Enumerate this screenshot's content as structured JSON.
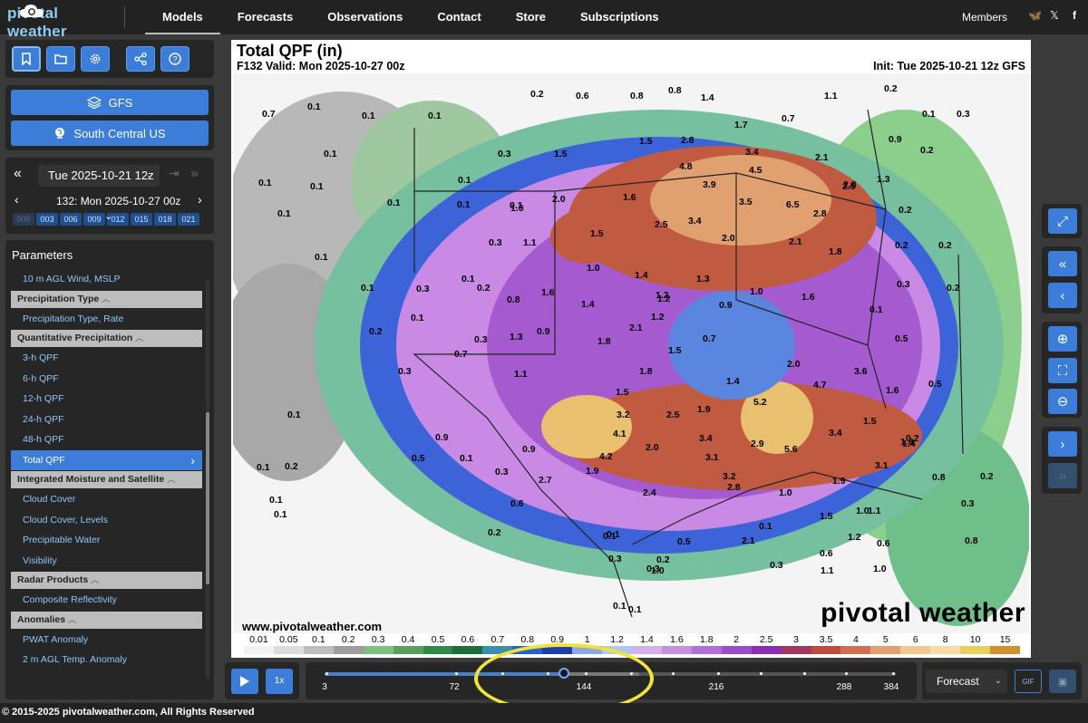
{
  "brand": {
    "name": "pivotal weather"
  },
  "nav": {
    "items": [
      "Models",
      "Forecasts",
      "Observations",
      "Contact",
      "Store",
      "Subscriptions"
    ],
    "members": "Members",
    "socials": [
      "bluesky-icon",
      "x-icon",
      "facebook-icon"
    ]
  },
  "sidebar": {
    "toolbar_icons": [
      "bookmark-icon",
      "folder-icon",
      "gear-icon",
      "share-icon",
      "help-icon"
    ],
    "model_label": "GFS",
    "region_label": "South Central US",
    "run_label": "Tue 2025-10-21 12z",
    "forecast_label": "132: Mon 2025-10-27 00z",
    "hour_chips": [
      "000",
      "003",
      "006",
      "009",
      "012",
      "015",
      "018",
      "021"
    ],
    "params_title": "Parameters",
    "params": [
      {
        "kind": "item",
        "label": "10 m AGL Wind, MSLP"
      },
      {
        "kind": "head",
        "label": "Precipitation Type"
      },
      {
        "kind": "item",
        "label": "Precipitation Type, Rate"
      },
      {
        "kind": "head",
        "label": "Quantitative Precipitation"
      },
      {
        "kind": "item",
        "label": "3-h QPF"
      },
      {
        "kind": "item",
        "label": "6-h QPF"
      },
      {
        "kind": "item",
        "label": "12-h QPF"
      },
      {
        "kind": "item",
        "label": "24-h QPF"
      },
      {
        "kind": "item",
        "label": "48-h QPF"
      },
      {
        "kind": "selected",
        "label": "Total QPF"
      },
      {
        "kind": "head",
        "label": "Integrated Moisture and Satellite"
      },
      {
        "kind": "item",
        "label": "Cloud Cover"
      },
      {
        "kind": "item",
        "label": "Cloud Cover, Levels"
      },
      {
        "kind": "item",
        "label": "Precipitable Water"
      },
      {
        "kind": "item",
        "label": "Visibility"
      },
      {
        "kind": "head",
        "label": "Radar Products"
      },
      {
        "kind": "item",
        "label": "Composite Reflectivity"
      },
      {
        "kind": "head",
        "label": "Anomalies"
      },
      {
        "kind": "item",
        "label": "PWAT Anomaly"
      },
      {
        "kind": "item",
        "label": "2 m AGL Temp. Anomaly"
      }
    ]
  },
  "map": {
    "title": "Total QPF (in)",
    "valid": "F132 Valid: Mon 2025-10-27 00z",
    "init": "Init: Tue 2025-10-21 12z GFS",
    "url": "www.pivotalweather.com",
    "watermark": "pivotal weather",
    "colorbar_labels": [
      "0.01",
      "0.05",
      "0.1",
      "0.2",
      "0.3",
      "0.4",
      "0.5",
      "0.6",
      "0.7",
      "0.8",
      "0.9",
      "1",
      "1.2",
      "1.4",
      "1.6",
      "1.8",
      "2",
      "2.5",
      "3",
      "3.5",
      "4",
      "5",
      "6",
      "8",
      "10",
      "15"
    ],
    "colorbar_colors": [
      "#f2f2f2",
      "#dcdcdc",
      "#bdbdbd",
      "#9e9e9e",
      "#7fbf7f",
      "#5aa05a",
      "#2f8a4a",
      "#1e6e3a",
      "#3a8fb0",
      "#2a5fd0",
      "#1f3fa8",
      "#8fa8e0",
      "#b0c8ee",
      "#d3b0e8",
      "#c890e0",
      "#b070d8",
      "#9a4fc8",
      "#8a2fb0",
      "#a03a60",
      "#c04a40",
      "#d07050",
      "#e0a070",
      "#f0c890",
      "#f7dca8",
      "#e8d060",
      "#d09030"
    ],
    "values": [
      "0.7",
      "0.1",
      "0.1",
      "0.1",
      "0.2",
      "0.6",
      "0.8",
      "0.8",
      "1.4",
      "1.1",
      "0.2",
      "0.1",
      "0.3",
      "1.7",
      "0.7",
      "0.2",
      "0.1",
      "0.3",
      "1.5",
      "1.5",
      "2.8",
      "3.4",
      "0.9",
      "4.8",
      "4.5",
      "2.1",
      "0.1",
      "0.1",
      "2.0",
      "2.8",
      "3.9",
      "2.5",
      "1.3",
      "0.1",
      "1.6",
      "3.5",
      "6.5",
      "0.2",
      "0.1",
      "0.1",
      "1.0",
      "2.5",
      "3.4",
      "2.8",
      "0.1",
      "0.1",
      "0.3",
      "1.1",
      "1.5",
      "2.0",
      "2.1",
      "0.2",
      "0.1",
      "1.0",
      "1.8",
      "0.2",
      "0.3",
      "0.2",
      "0.1",
      "0.1",
      "1.6",
      "1.4",
      "1.3",
      "1.0",
      "1.6",
      "0.3",
      "0.2",
      "0.8",
      "1.2",
      "0.9",
      "1.2",
      "0.1",
      "1.4",
      "1.2",
      "0.1",
      "0.2",
      "0.9",
      "2.1",
      "1.8",
      "0.7",
      "0.5",
      "0.3",
      "0.7",
      "1.3",
      "1.5",
      "0.3",
      "1.1",
      "1.8",
      "2.0",
      "3.6",
      "0.5",
      "1.4",
      "4.7",
      "1.6",
      "1.5",
      "5.2",
      "1.9",
      "0.1",
      "3.2",
      "2.5",
      "0.9",
      "4.1",
      "3.4",
      "2.9",
      "5.6",
      "3.4",
      "1.5",
      "1.4",
      "0.2",
      "0.5",
      "4.2",
      "2.0",
      "3.1",
      "1.8",
      "0.9",
      "3.1",
      "1.9",
      "2.7",
      "0.3",
      "3.2",
      "2.8",
      "1.9",
      "0.8",
      "0.2",
      "0.6",
      "2.4",
      "1.0",
      "1.0",
      "1.1",
      "0.3",
      "0.1",
      "0.1",
      "1.5",
      "1.2",
      "0.6",
      "0.5",
      "0.2",
      "2.1",
      "0.8",
      "0.3",
      "0.3",
      "1.1",
      "1.0",
      "1.0",
      "0.6",
      "0.2",
      "0.1",
      "0.1",
      "0.1",
      "0.1",
      "0.3",
      "0.2",
      "0.1",
      "0.1",
      "0.1"
    ]
  },
  "right_controls": [
    "expand-icon",
    "rewind-icon",
    "prev-icon",
    "zoom-in-icon",
    "fullscreen-icon",
    "zoom-out-icon",
    "next-icon",
    "fast-forward-icon"
  ],
  "playback": {
    "speed": "1x",
    "ticks": [
      "3",
      "72",
      "144",
      "216",
      "288",
      "384"
    ],
    "mode": "Forecast",
    "gif": "GIF"
  },
  "footer": "© 2015-2025 pivotalweather.com, All Rights Reserved"
}
